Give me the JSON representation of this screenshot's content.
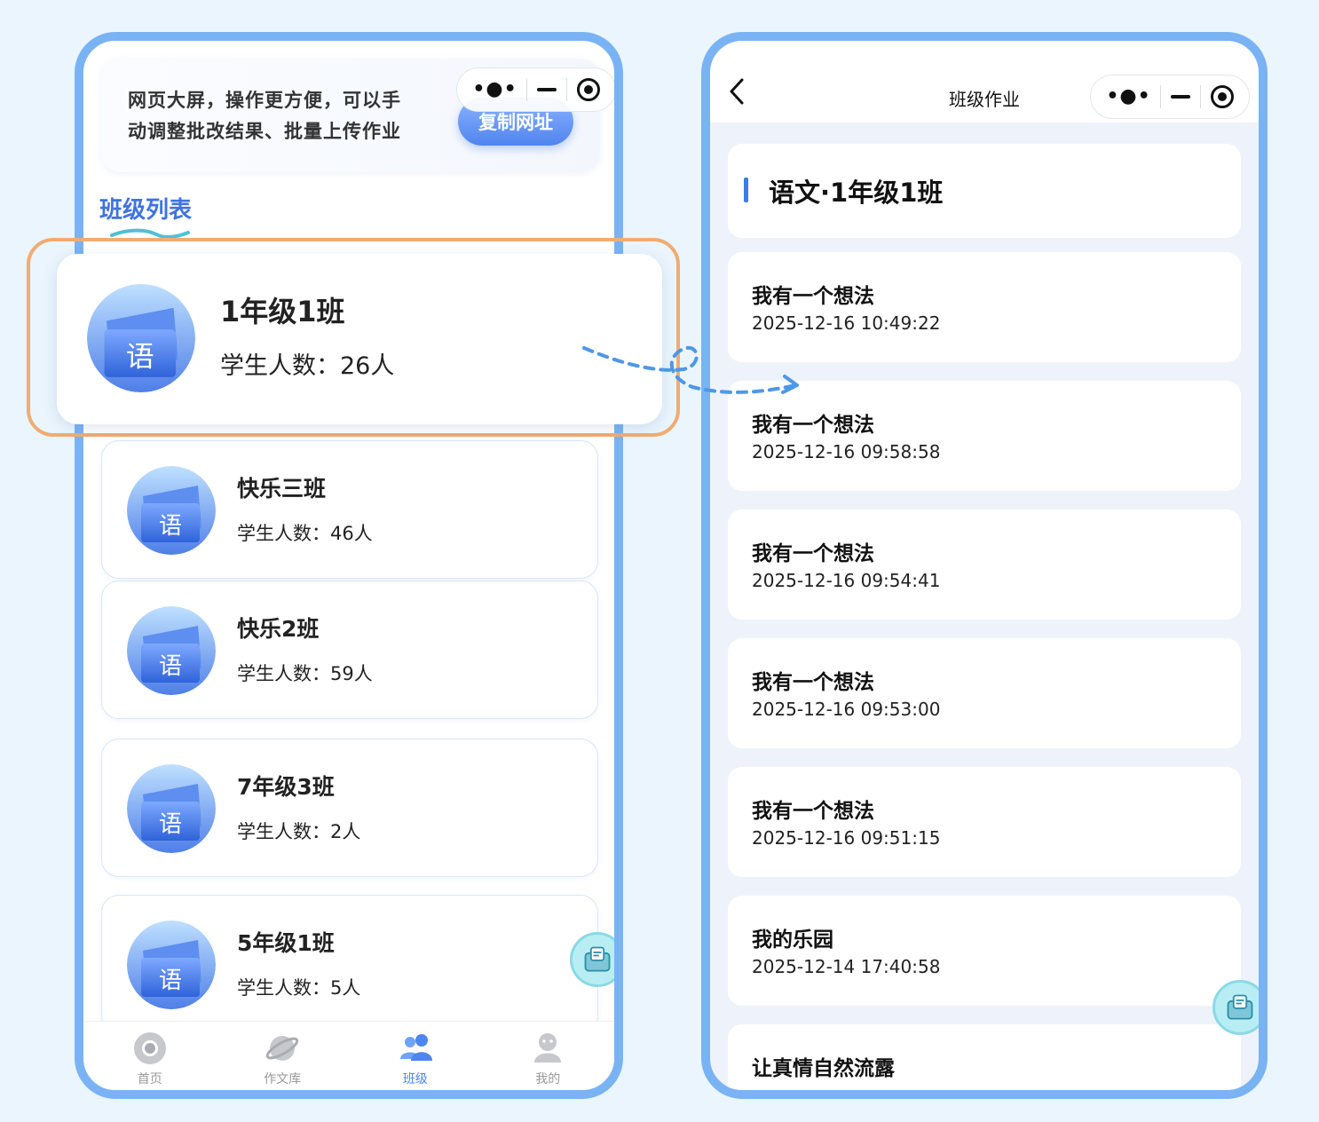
{
  "left": {
    "banner_line1": "网页大屏，操作更方便，可以手",
    "banner_line2": "动调整批改结果、批量上传作业",
    "copy_button": "复制网址",
    "section_title": "班级列表",
    "subject_icon_char": "语",
    "classes": [
      {
        "name": "1年级1班",
        "count": "学生人数：26人"
      },
      {
        "name": "快乐三班",
        "count": "学生人数：46人"
      },
      {
        "name": "快乐2班",
        "count": "学生人数：59人"
      },
      {
        "name": "7年级3班",
        "count": "学生人数：2人"
      },
      {
        "name": "5年级1班",
        "count": "学生人数：5人"
      }
    ],
    "tabs": [
      {
        "label": "首页",
        "icon": "home-icon"
      },
      {
        "label": "作文库",
        "icon": "planet-icon"
      },
      {
        "label": "班级",
        "icon": "class-group-icon",
        "active": true
      },
      {
        "label": "我的",
        "icon": "profile-icon"
      }
    ]
  },
  "right": {
    "title": "班级作业",
    "class_title": "语文·1年级1班",
    "homeworks": [
      {
        "title": "我有一个想法",
        "time": "2025-12-16 10:49:22"
      },
      {
        "title": "我有一个想法",
        "time": "2025-12-16 09:58:58"
      },
      {
        "title": "我有一个想法",
        "time": "2025-12-16 09:54:41"
      },
      {
        "title": "我有一个想法",
        "time": "2025-12-16 09:53:00"
      },
      {
        "title": "我有一个想法",
        "time": "2025-12-16 09:51:15"
      },
      {
        "title": "我的乐园",
        "time": "2025-12-14 17:40:58"
      },
      {
        "title": "让真情自然流露",
        "time": ""
      }
    ]
  },
  "colors": {
    "accent": "#4c86ee",
    "frame": "#7ab3f4",
    "highlight": "#f0ac73",
    "background": "#eaf5fd"
  }
}
